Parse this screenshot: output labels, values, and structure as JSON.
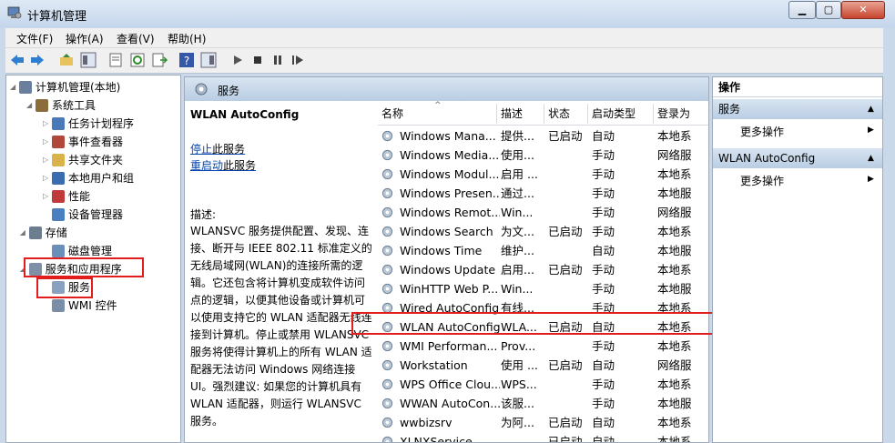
{
  "window": {
    "title": "计算机管理",
    "min": "▁",
    "max": "▢",
    "close": "✕"
  },
  "menu": [
    "文件(F)",
    "操作(A)",
    "查看(V)",
    "帮助(H)"
  ],
  "tree": [
    {
      "label": "计算机管理(本地)",
      "indent": 0,
      "tri": "◢",
      "color": "#6a7f9e"
    },
    {
      "label": "系统工具",
      "indent": 1,
      "tri": "◢",
      "color": "#8a6d3b"
    },
    {
      "label": "任务计划程序",
      "indent": 2,
      "tri": "▷",
      "color": "#4a7ab8"
    },
    {
      "label": "事件查看器",
      "indent": 2,
      "tri": "▷",
      "color": "#b0473a"
    },
    {
      "label": "共享文件夹",
      "indent": 2,
      "tri": "▷",
      "color": "#d8b34a"
    },
    {
      "label": "本地用户和组",
      "indent": 2,
      "tri": "▷",
      "color": "#3a6db0"
    },
    {
      "label": "性能",
      "indent": 2,
      "tri": "▷",
      "color": "#c03a3a"
    },
    {
      "label": "设备管理器",
      "indent": 2,
      "tri": "",
      "color": "#4a80c0"
    },
    {
      "label": "存储",
      "indent": 0.6,
      "tri": "◢",
      "color": "#6b7d8f"
    },
    {
      "label": "磁盘管理",
      "indent": 2,
      "tri": "",
      "color": "#6b8fb8"
    },
    {
      "label": "服务和应用程序",
      "indent": 0.6,
      "tri": "◢",
      "color": "#7f8fa6"
    },
    {
      "label": "服务",
      "indent": 2,
      "tri": "",
      "color": "#8aa2bf"
    },
    {
      "label": "WMI 控件",
      "indent": 2,
      "tri": "",
      "color": "#7a8ea8"
    }
  ],
  "center": {
    "header": "服务",
    "selected_name": "WLAN AutoConfig",
    "stop_link": "停止",
    "stop_suffix": "此服务",
    "restart_link": "重启动",
    "restart_suffix": "此服务",
    "desc_label": "描述:",
    "desc_text": "WLANSVC 服务提供配置、发现、连\n接、断开与 IEEE 802.11 标准定义的\n无线局域网(WLAN)的连接所需的逻\n辑。它还包含将计算机变成软件访问\n点的逻辑，以便其他设备或计算机可\n以使用支持它的 WLAN 适配器无线连\n接到计算机。停止或禁用 WLANSVC\n服务将使得计算机上的所有 WLAN 适\n配器无法访问 Windows 网络连接\nUI。强烈建议: 如果您的计算机具有\nWLAN 适配器，则运行 WLANSVC\n服务。"
  },
  "table": {
    "columns": [
      "名称",
      "描述",
      "状态",
      "启动类型",
      "登录为"
    ],
    "rows": [
      [
        "Windows Mana...",
        "提供...",
        "已启动",
        "自动",
        "本地系"
      ],
      [
        "Windows Media...",
        "使用...",
        "",
        "手动",
        "网络服"
      ],
      [
        "Windows Modul...",
        "启用 ...",
        "",
        "手动",
        "本地系"
      ],
      [
        "Windows Presen...",
        "通过...",
        "",
        "手动",
        "本地服"
      ],
      [
        "Windows Remot...",
        "Win...",
        "",
        "手动",
        "网络服"
      ],
      [
        "Windows Search",
        "为文...",
        "已启动",
        "手动",
        "本地系"
      ],
      [
        "Windows Time",
        "维护...",
        "",
        "自动",
        "本地服"
      ],
      [
        "Windows Update",
        "启用...",
        "已启动",
        "手动",
        "本地系"
      ],
      [
        "WinHTTP Web P...",
        "Win...",
        "",
        "手动",
        "本地服"
      ],
      [
        "Wired AutoConfig",
        "有线...",
        "",
        "手动",
        "本地系"
      ],
      [
        "WLAN AutoConfig",
        "WLA...",
        "已启动",
        "自动",
        "本地系"
      ],
      [
        "WMI Performan...",
        "Prov...",
        "",
        "手动",
        "本地系"
      ],
      [
        "Workstation",
        "使用 ...",
        "已启动",
        "自动",
        "网络服"
      ],
      [
        "WPS Office Clou...",
        "WPS...",
        "",
        "手动",
        "本地系"
      ],
      [
        "WWAN AutoCon...",
        "该服...",
        "",
        "手动",
        "本地服"
      ],
      [
        "wwbizsrv",
        "为阿...",
        "已启动",
        "自动",
        "本地系"
      ],
      [
        "XLNXService",
        "",
        "已启动",
        "自动",
        "本地系"
      ]
    ]
  },
  "actions": {
    "title": "操作",
    "group1": "服务",
    "more1": "更多操作",
    "group2": "WLAN AutoConfig",
    "more2": "更多操作"
  }
}
